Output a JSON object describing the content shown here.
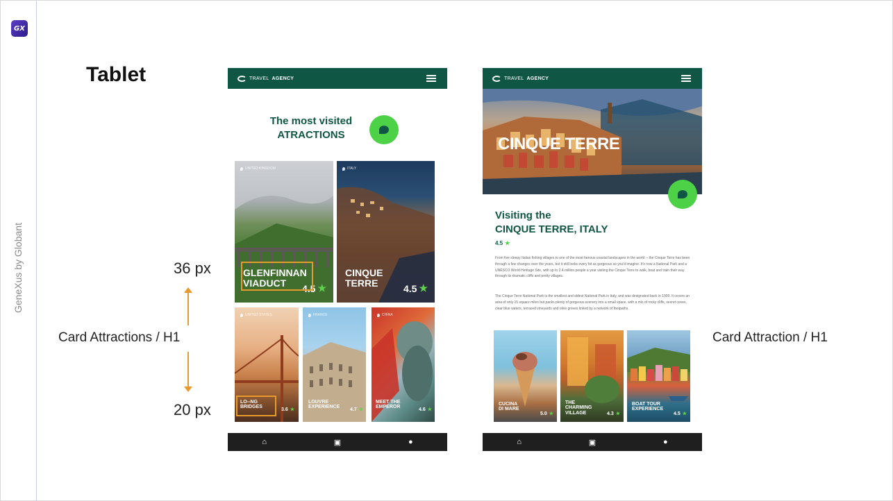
{
  "slide": {
    "title": "Tablet",
    "side_brand": "GeneXus by Globant",
    "logo_text": "GX",
    "label_36": "36 px",
    "label_20": "20 px",
    "caption_left": "Card Attractions / H1",
    "caption_right": "Card Attraction / H1"
  },
  "colors": {
    "brand_green": "#0f5744",
    "accent_green": "#4cd147",
    "highlight_orange": "#e89a2c",
    "nav_dark": "#1f1f1f"
  },
  "tablet_left": {
    "brand_light": "TRAVEL",
    "brand_bold": "AGENCY",
    "headline_line1": "The most visited",
    "headline_line2": "ATRACTIONS",
    "cards": [
      {
        "tag": "UNITED KINGDOM",
        "title_line1": "GLENFINNAN",
        "title_line2": "VIADUCT",
        "rating": "4.5"
      },
      {
        "tag": "ITALY",
        "title_line1": "CINQUE",
        "title_line2": "TERRE",
        "rating": "4.5"
      },
      {
        "tag": "UNITED STATES",
        "title_line1": "LO--NG",
        "title_line2": "BRIDGES",
        "rating": "3.6"
      },
      {
        "tag": "FRANCE",
        "title_line1": "LOUVRE",
        "title_line2": "EXPERIENCE",
        "rating": "4.7"
      },
      {
        "tag": "CHINA",
        "title_line1": "MEET THE",
        "title_line2": "EMPEROR",
        "rating": "4.6"
      }
    ],
    "nav": [
      "home-icon",
      "calendar-icon",
      "profile-icon"
    ]
  },
  "tablet_right": {
    "brand_light": "TRAVEL",
    "brand_bold": "AGENCY",
    "hero_title": "CINQUE TERRE",
    "detail_line1": "Visiting the",
    "detail_line2": "CINQUE TERRE, ITALY",
    "rating": "4.5",
    "paragraph1": "From five sleepy Italian fishing villages to one of the most famous coastal landscapes in the world -- the Cinque Terre has been through a few changes over the years, but it still looks every bit as gorgeous as you'd imagine. It's now a National Park and a UNESCO World Heritage Site, with up to 2.4 million people a year visiting the Cinque Terre to walk, boat and train their way through its dramatic cliffs and pretty villages.",
    "paragraph2": "The Cinque Terre National Park is the smallest and oldest National Park in Italy, and was designated back in 1999. It covers an area of only 15 square miles but packs plenty of gorgeous scenery into a small space, with a mix of rocky cliffs, secret coves, clear blue waters, terraced vineyards and olive groves linked by a network of footpaths.",
    "cards": [
      {
        "title_line1": "CUCINA",
        "title_line2": "DI MARE",
        "title_line3": "",
        "rating": "5.0"
      },
      {
        "title_line1": "THE",
        "title_line2": "CHARMING",
        "title_line3": "VILLAGE",
        "rating": "4.3"
      },
      {
        "title_line1": "BOAT TOUR",
        "title_line2": "EXPERIENCE",
        "title_line3": "",
        "rating": "4.5"
      }
    ],
    "nav": [
      "home-icon",
      "calendar-icon",
      "profile-icon"
    ]
  }
}
